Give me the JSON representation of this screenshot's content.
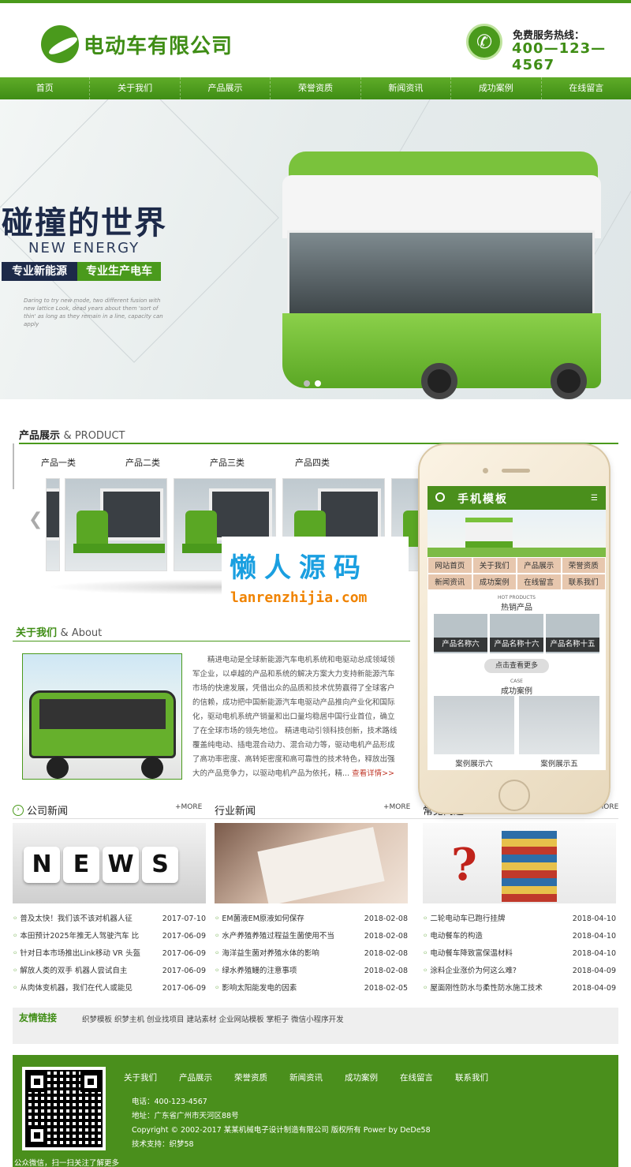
{
  "header": {
    "logo_text": "电动车有限公司",
    "hotline_label": "免费服务热线：",
    "hotline_number": "400—123—4567",
    "brand_color": "#4a9a1c"
  },
  "nav": [
    "首页",
    "关于我们",
    "产品展示",
    "荣誉资质",
    "新闻资讯",
    "成功案例",
    "在线留言"
  ],
  "banner": {
    "title": "碰撞的世界",
    "subtitle": "NEW ENERGY",
    "tag1": "专业新能源",
    "tag2": "专业生产电车",
    "small_text": "Daring to try new mode, two different fusion with new lattice Look, dead years about them 'sort of thin' as long as they remain in a line, capacity can apply"
  },
  "products": {
    "title": "产品展示",
    "title_en": "& PRODUCT",
    "tabs": [
      "产品一类",
      "产品二类",
      "产品三类",
      "产品四类"
    ]
  },
  "about": {
    "title": "关于我们",
    "title_en": "& About",
    "text": "精进电动是全球新能源汽车电机系统和电驱动总成领域领军企业，以卓越的产品和系统的解决方案大力支持新能源汽车市场的快速发展，凭借出众的品质和技术优势赢得了全球客户的信赖，成功把中国新能源汽车电驱动产品推向产业化和国际化，驱动电机系统产销量和出口量均稳居中国行业首位，确立了在全球市场的领先地位。 精进电动引领科技创新，技术路线覆盖纯电动、插电混合动力、混合动力等，驱动电机产品形成了高功率密度、高转矩密度和高可靠性的技术特色，释放出强大的产品竞争力，以驱动电机产品为依托，精... ",
    "more": "查看详情>>"
  },
  "news": [
    {
      "title": "公司新闻",
      "more": "+MORE",
      "image_word": "NEWS",
      "items": [
        {
          "t": "普及太快！我们该不该对机器人征",
          "d": "2017-07-10"
        },
        {
          "t": "本田预计2025年推无人驾驶汽车 比",
          "d": "2017-06-09"
        },
        {
          "t": "针对日本市场推出Link移动 VR 头盔",
          "d": "2017-06-09"
        },
        {
          "t": "解放人类的双手 机器人尝试自主",
          "d": "2017-06-09"
        },
        {
          "t": "从肉体变机器，我们在代人或能见",
          "d": "2017-06-09"
        }
      ]
    },
    {
      "title": "行业新闻",
      "more": "+MORE",
      "items": [
        {
          "t": "EM菌液EM原液如何保存",
          "d": "2018-02-08"
        },
        {
          "t": "水产养殖养殖过程益生菌使用不当",
          "d": "2018-02-08"
        },
        {
          "t": "海洋益生菌对养殖水体的影响",
          "d": "2018-02-08"
        },
        {
          "t": "绿水养殖鳗的注意事项",
          "d": "2018-02-08"
        },
        {
          "t": "影响太阳能发电的因素",
          "d": "2018-02-05"
        }
      ]
    },
    {
      "title": "常见问题",
      "more": "+MORE",
      "items": [
        {
          "t": "二轮电动车已跑行挂牌",
          "d": "2018-04-10"
        },
        {
          "t": "电动餐车的构造",
          "d": "2018-04-10"
        },
        {
          "t": "电动餐车降致富保温材料",
          "d": "2018-04-10"
        },
        {
          "t": "涂料企业涨价为何这么难?",
          "d": "2018-04-09"
        },
        {
          "t": "屋面刚性防水与柔性防水施工技术",
          "d": "2018-04-09"
        }
      ]
    }
  ],
  "links": {
    "title": "友情链接",
    "items": "织梦模板 织梦主机 创业找项目 建站素材 企业网站模板 掌柜子 微信小程序开发"
  },
  "footer": {
    "nav": [
      "关于我们",
      "产品展示",
      "荣誉资质",
      "新闻资讯",
      "成功案例",
      "在线留言",
      "联系我们"
    ],
    "phone": "电话：400-123-4567",
    "address": "地址：广东省广州市天河区88号",
    "copyright": "Copyright © 2002-2017 某某机械电子设计制造有限公司 版权所有 Power by DeDe58",
    "support": "技术支持：织梦58",
    "qr_caption": "公众微信，扫一扫关注了解更多"
  },
  "mobile": {
    "title": "手机模板",
    "nav": [
      "网站首页",
      "关于我们",
      "产品展示",
      "荣誉资质",
      "新闻资讯",
      "成功案例",
      "在线留言",
      "联系我们"
    ],
    "hot_en": "HOT PRODUCTS",
    "hot_cn": "热销产品",
    "products": [
      "产品名称六",
      "产品名称十六",
      "产品名称十五"
    ],
    "more_btn": "点击查看更多",
    "case_en": "CASE",
    "case_cn": "成功案例",
    "cases": [
      "案例展示六",
      "案例展示五"
    ]
  },
  "watermark": {
    "cn": "懒人源码",
    "en": "lanrenzhijia.com"
  }
}
